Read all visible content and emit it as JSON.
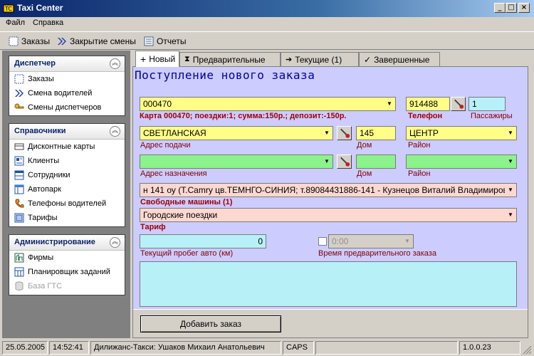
{
  "window": {
    "title": "Taxi Center"
  },
  "menu": {
    "file": "Файл",
    "help": "Справка"
  },
  "toolbar": {
    "orders": "Заказы",
    "close_shift": "Закрытие смены",
    "reports": "Отчеты"
  },
  "sidebar": {
    "dispatcher": {
      "title": "Диспетчер",
      "items": [
        "Заказы",
        "Смена водителей",
        "Смены диспетчеров"
      ]
    },
    "reference": {
      "title": "Справочники",
      "items": [
        "Дисконтные карты",
        "Клиенты",
        "Сотрудники",
        "Автопарк",
        "Телефоны водителей",
        "Тарифы"
      ]
    },
    "admin": {
      "title": "Администрирование",
      "items": [
        "Фирмы",
        "Планировщик заданий",
        "База ГТС"
      ]
    }
  },
  "tabs": [
    "Новый",
    "Предварительные",
    "Текущие (1)",
    "Завершенные"
  ],
  "main": {
    "title": "Поступление нового заказа",
    "card_value": "000470",
    "card_info": "Карта 000470; поездки:1; сумма:150р.; депозит:-150р.",
    "phone_value": "914488",
    "phone_label": "Телефон",
    "passengers_value": "1",
    "passengers_label": "Пассажиры",
    "pickup_address": "СВЕТЛАНСКАЯ",
    "pickup_label": "Адрес подачи",
    "pickup_house": "145",
    "house_label": "Дом",
    "pickup_district": "ЦЕНТР",
    "district_label": "Район",
    "dest_address": "",
    "dest_label": "Адрес назначения",
    "dest_house": "",
    "dest_district": "",
    "car_value": "н 141 оу (Т.Camry цв.ТЕМНГО-СИНИЯ; т.89084431886-141 - Кузнецов Виталий Владимирович",
    "cars_label": "Свободные машины (1)",
    "tariff_value": "Городские поездки",
    "tariff_label": "Тариф",
    "mileage_value": "0",
    "mileage_label": "Текущий пробег авто (км)",
    "prelim_time_value": "0:00",
    "prelim_time_label": "Время предварительного заказа",
    "add_button": "Добавить заказ"
  },
  "status": {
    "date": "25.05.2005",
    "time": "14:52:41",
    "user": "Дилижанс-Такси: Ушаков Михаил Анатольевич",
    "caps": "CAPS",
    "version": "1.0.0.23"
  },
  "colors": {
    "title_bar": "#0a246a",
    "form_bg": "#ccccff",
    "field_yellow": "#ffff88",
    "field_green": "#8cf28c",
    "field_cyan": "#b8f0f8",
    "field_pink": "#fcd8d0",
    "label_red": "#a00000"
  }
}
